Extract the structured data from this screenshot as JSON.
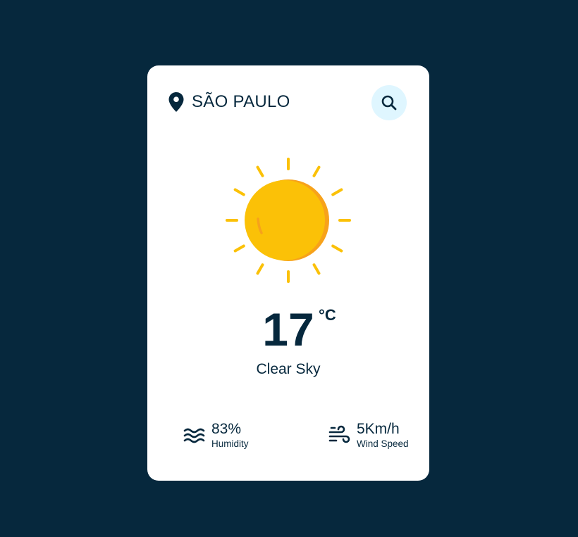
{
  "location": {
    "city": "SÃO PAULO",
    "icon": "map-pin-icon"
  },
  "search": {
    "icon": "search-icon"
  },
  "weather": {
    "icon": "sun-icon",
    "temperature": "17",
    "unit": "°C",
    "description": "Clear Sky"
  },
  "details": {
    "humidity": {
      "value": "83%",
      "label": "Humidity",
      "icon": "waves-icon"
    },
    "wind": {
      "value": "5Km/h",
      "label": "Wind Speed",
      "icon": "wind-icon"
    }
  },
  "colors": {
    "background": "#06283d",
    "card": "#ffffff",
    "accent": "#dff6ff",
    "sun": "#fbc107",
    "sun_shade": "#f7a21b"
  }
}
